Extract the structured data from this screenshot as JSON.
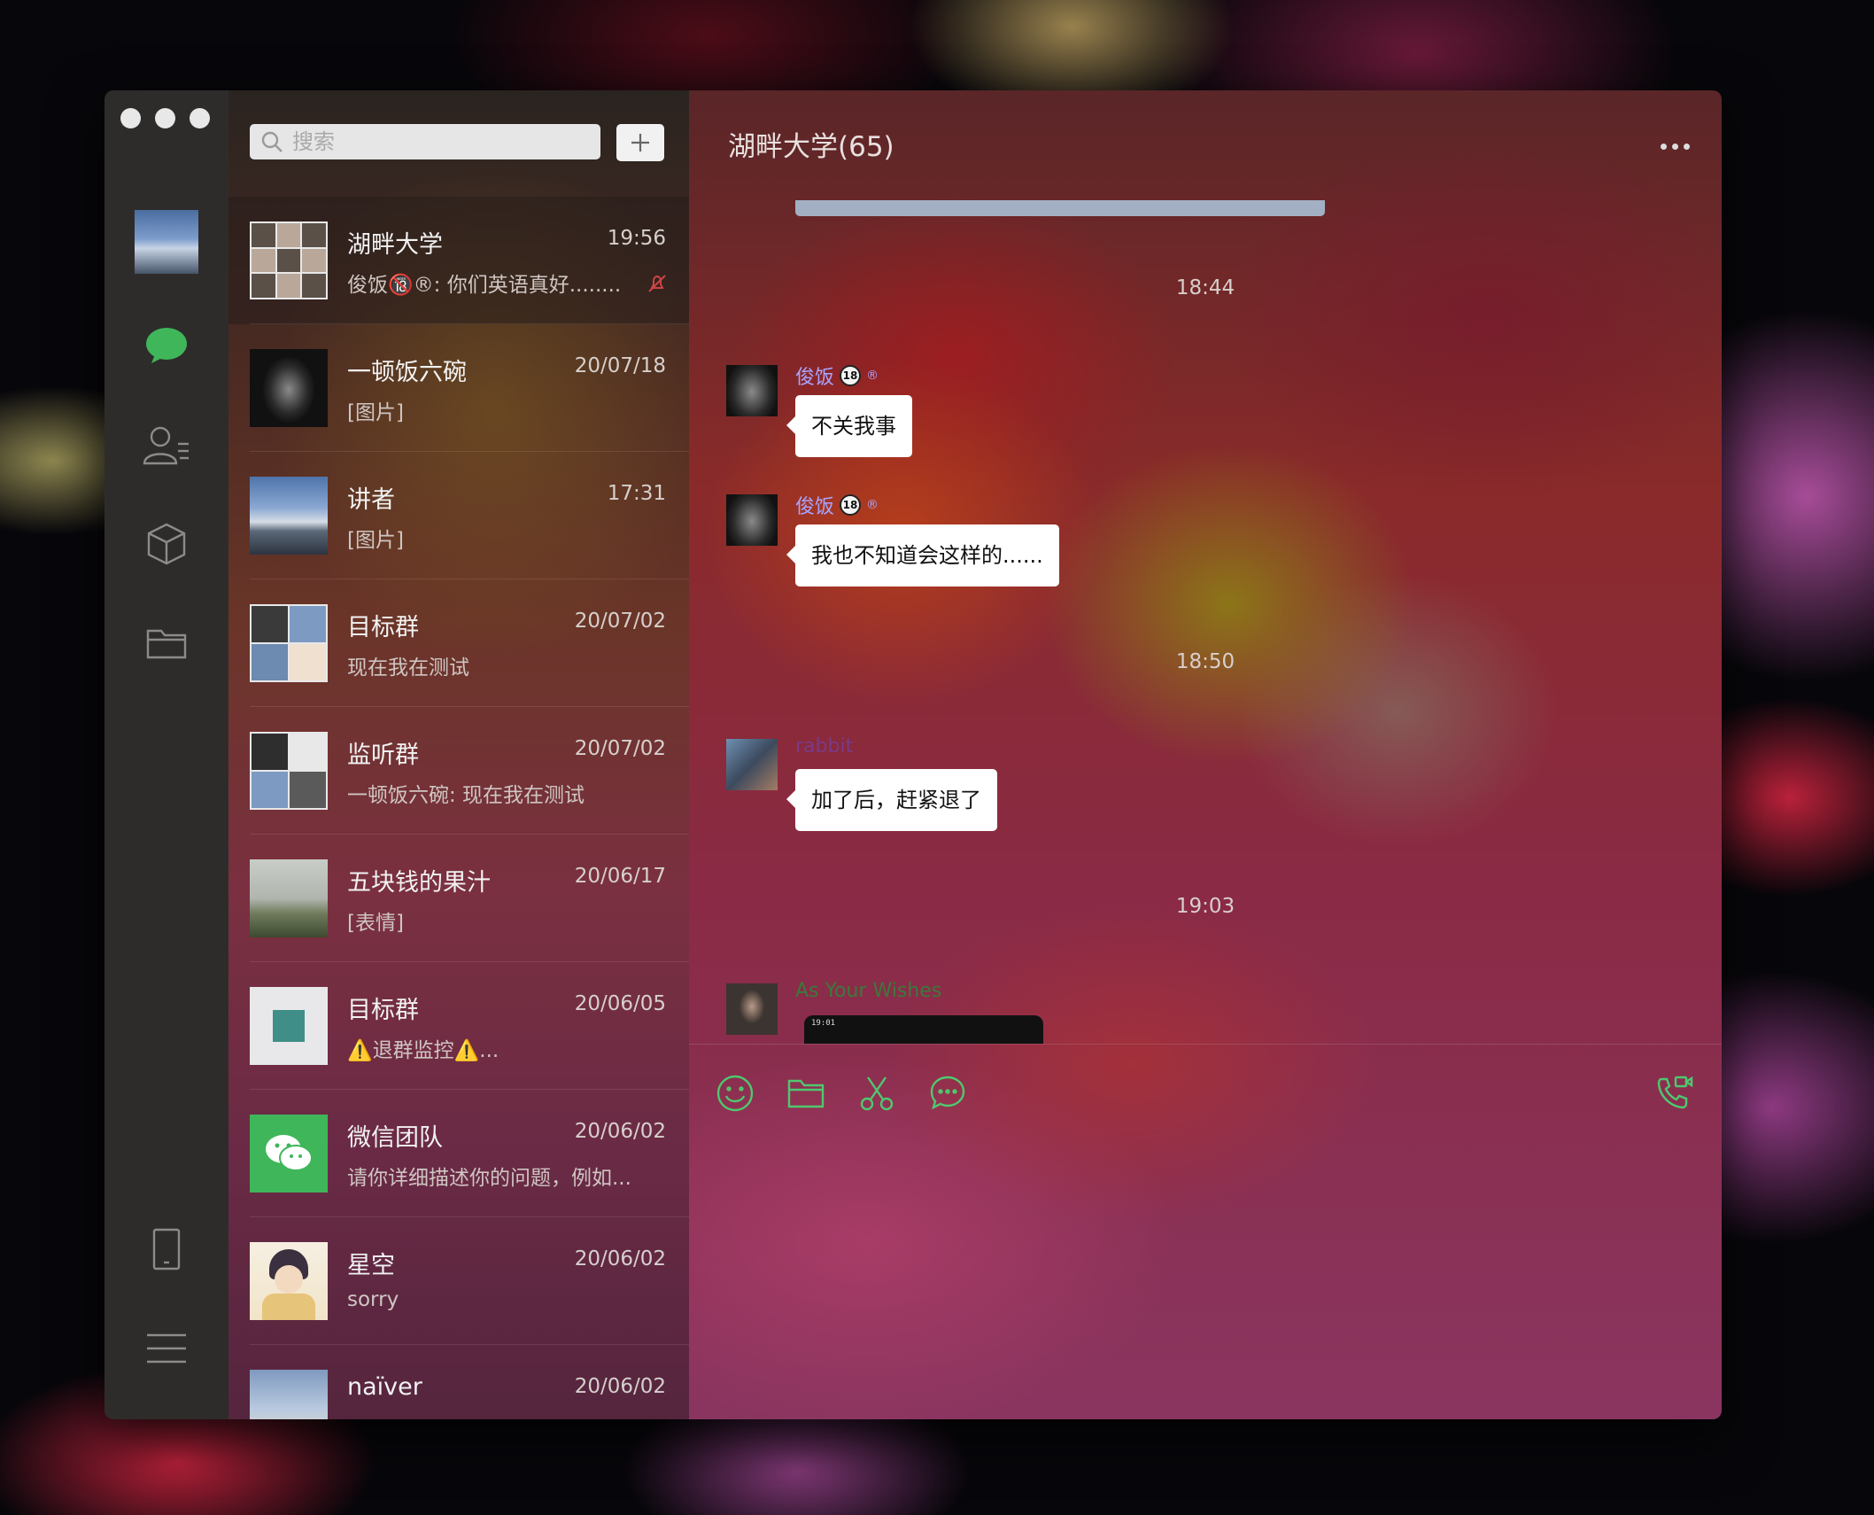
{
  "window": {
    "title": "湖畔大学(65)"
  },
  "search": {
    "placeholder": "搜索"
  },
  "toolbar_add": "+",
  "chats": [
    {
      "name": "湖畔大学",
      "time": "19:56",
      "preview": "俊饭🔞®: 你们英语真好........",
      "muted": true,
      "active": true
    },
    {
      "name": "一顿饭六碗",
      "time": "20/07/18",
      "preview": "[图片]"
    },
    {
      "name": "讲者",
      "time": "17:31",
      "preview": "[图片]"
    },
    {
      "name": "目标群",
      "time": "20/07/02",
      "preview": "现在我在测试"
    },
    {
      "name": "监听群",
      "time": "20/07/02",
      "preview": "一顿饭六碗: 现在我在测试"
    },
    {
      "name": "五块钱的果汁",
      "time": "20/06/17",
      "preview": "[表情]"
    },
    {
      "name": "目标群",
      "time": "20/06/05",
      "preview": "⚠️退群监控⚠️..."
    },
    {
      "name": "微信团队",
      "time": "20/06/02",
      "preview": "请你详细描述你的问题，例如..."
    },
    {
      "name": "星空",
      "time": "20/06/02",
      "preview": "sorry"
    },
    {
      "name": "naïver",
      "time": "20/06/02",
      "preview": ""
    }
  ],
  "messages": {
    "ts1": "18:44",
    "m1_sender": "俊饭",
    "m1_text": "不关我事",
    "m2_sender": "俊饭",
    "m2_text": "我也不知道会这样的......",
    "ts2": "18:50",
    "m3_sender": "rabbit",
    "m3_text": "加了后，赶紧退了",
    "ts3": "19:03",
    "m4_sender": "As Your Wishes",
    "m4_image_text": "19:01"
  },
  "badges": {
    "age": "18",
    "reg": "®"
  },
  "colors": {
    "accent_green": "#4ec86e",
    "sender_junfan": "#a9a4ff",
    "sender_rabbit": "#7a3a8a",
    "sender_wishes": "#3a7a3a"
  },
  "icons": {
    "nav": [
      "chat-icon",
      "contacts-icon",
      "box-icon",
      "folder-icon",
      "phone-icon",
      "menu-icon"
    ],
    "tools": [
      "emoji-icon",
      "folder-icon",
      "scissors-icon",
      "chat-bubble-icon",
      "video-call-icon"
    ]
  }
}
